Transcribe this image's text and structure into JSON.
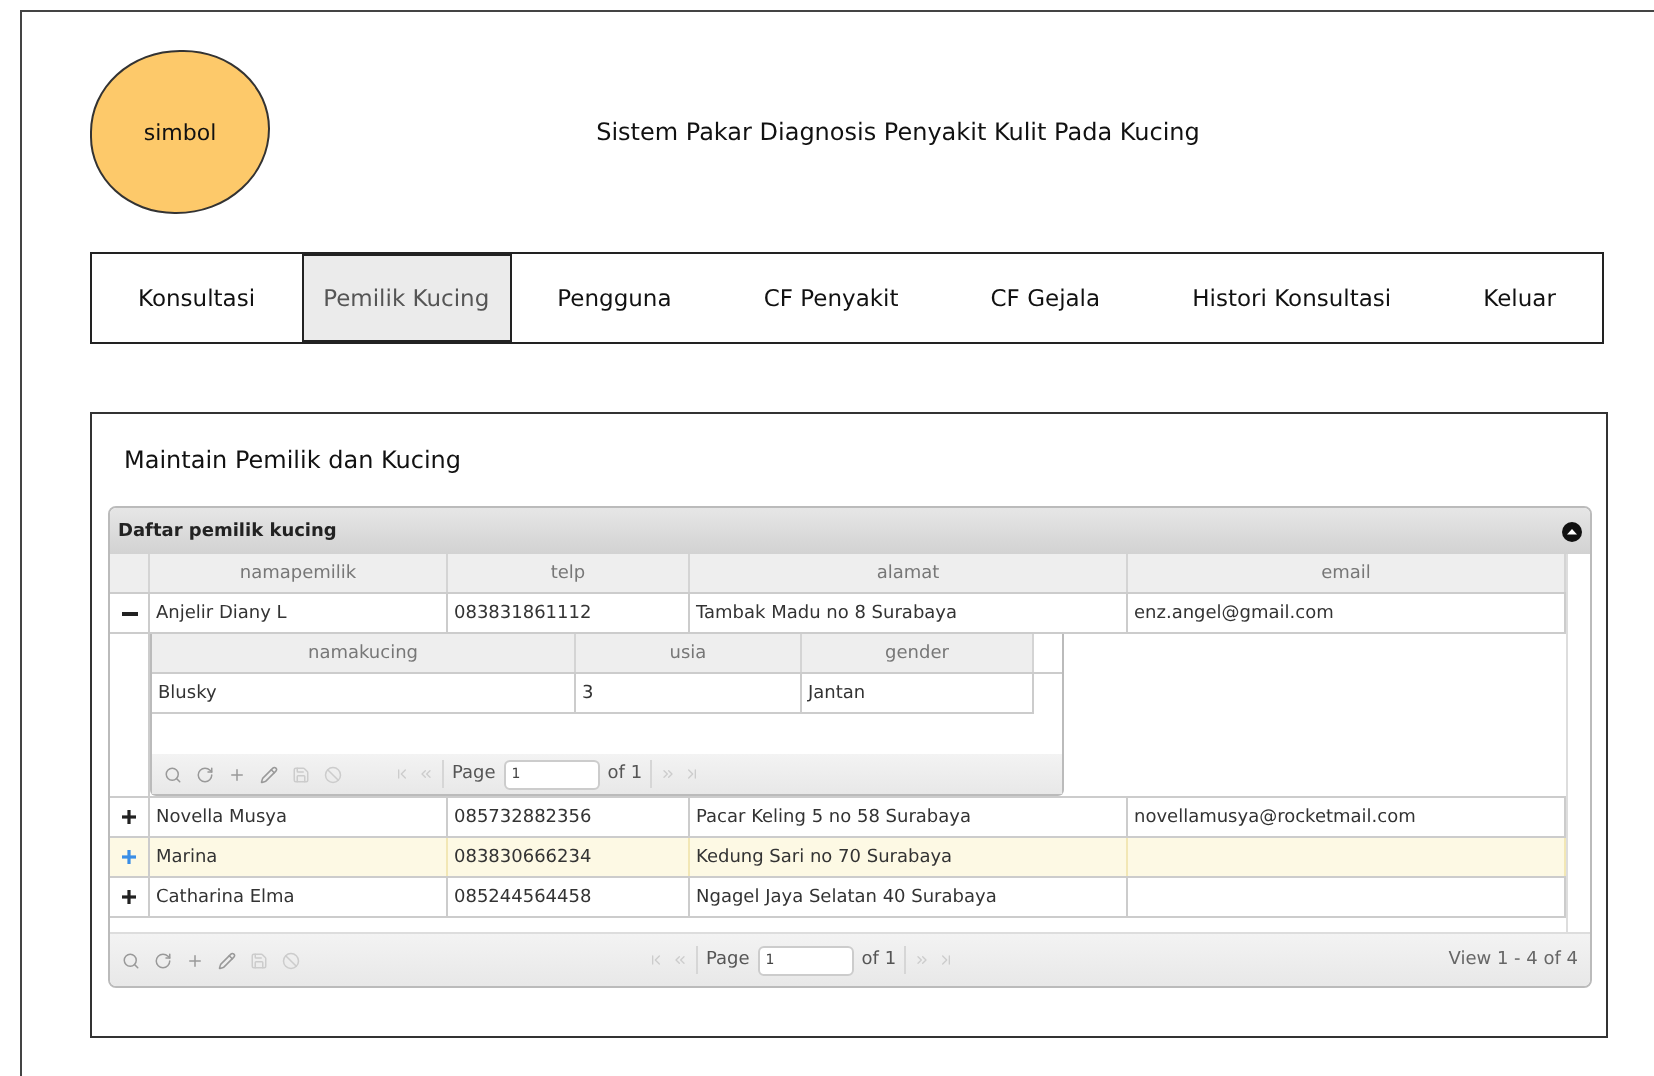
{
  "logo": {
    "label": "simbol"
  },
  "header": {
    "title": "Sistem Pakar Diagnosis Penyakit Kulit Pada Kucing"
  },
  "nav": [
    {
      "label": "Konsultasi",
      "selected": false
    },
    {
      "label": "Pemilik Kucing",
      "selected": true
    },
    {
      "label": "Pengguna",
      "selected": false
    },
    {
      "label": "CF Penyakit",
      "selected": false
    },
    {
      "label": "CF Gejala",
      "selected": false
    },
    {
      "label": "Histori Konsultasi",
      "selected": false
    },
    {
      "label": "Keluar",
      "selected": false
    }
  ],
  "panel": {
    "title": "Maintain Pemilik dan Kucing",
    "grid": {
      "caption": "Daftar pemilik kucing",
      "columns": [
        "namapemilik",
        "telp",
        "alamat",
        "email"
      ],
      "rows": [
        {
          "cells": [
            "Anjelir Diany L",
            "083831861112",
            "Tambak Madu no 8 Surabaya",
            "enz.angel@gmail.com"
          ],
          "expanded": true,
          "selected": false,
          "subgrid": {
            "columns": [
              "namakucing",
              "usia",
              "gender"
            ],
            "rows": [
              [
                "Blusky",
                "3",
                "Jantan"
              ]
            ],
            "pager": {
              "page_label": "Page",
              "page_value": "1",
              "of_label": "of 1"
            }
          }
        },
        {
          "cells": [
            "Novella Musya",
            "085732882356",
            "Pacar Keling 5 no 58 Surabaya",
            "novellamusya@rocketmail.com"
          ],
          "expanded": false,
          "selected": false
        },
        {
          "cells": [
            "Marina",
            "083830666234",
            "Kedung Sari no 70 Surabaya",
            ""
          ],
          "expanded": false,
          "selected": true
        },
        {
          "cells": [
            "Catharina Elma",
            "085244564458",
            "Ngagel Jaya Selatan 40 Surabaya",
            ""
          ],
          "expanded": false,
          "selected": false
        }
      ],
      "pager": {
        "page_label": "Page",
        "page_value": "1",
        "of_label": "of 1",
        "view": "View 1 - 4 of 4"
      }
    }
  }
}
